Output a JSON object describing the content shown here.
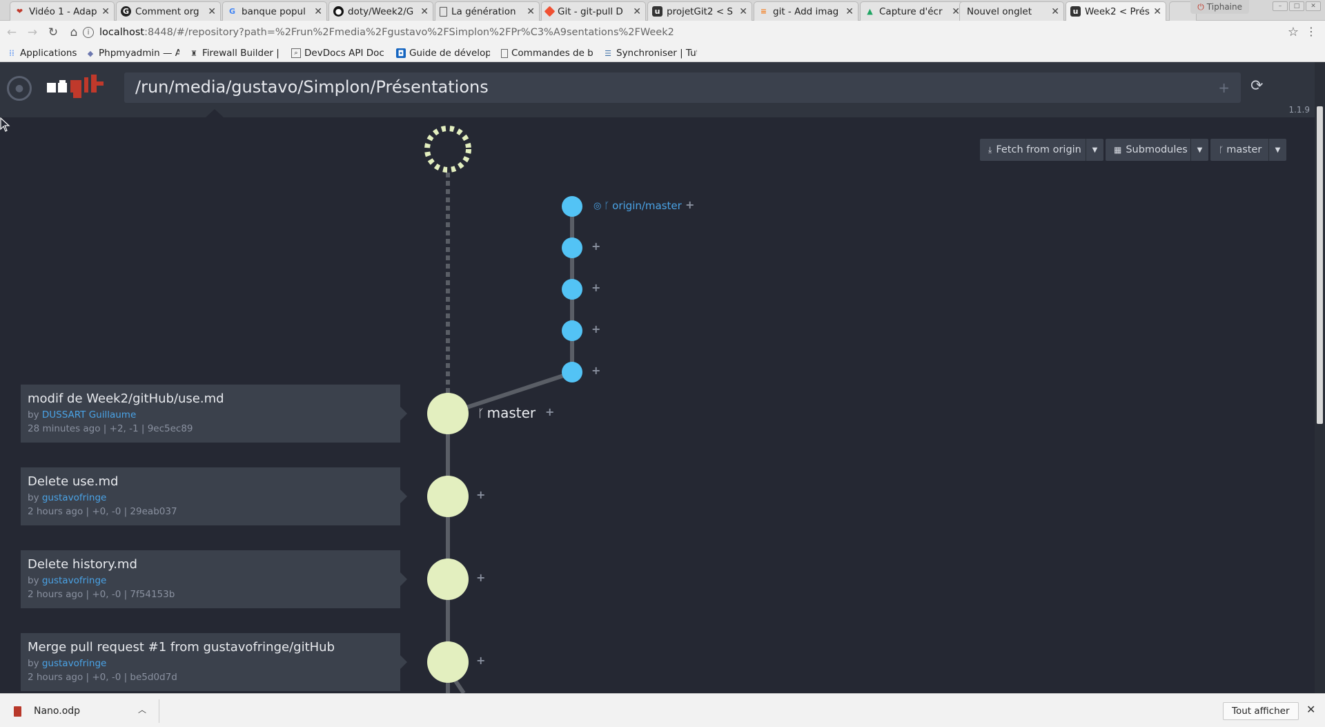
{
  "browser": {
    "tabs": [
      {
        "title": "Vidéo 1 - Adap",
        "icon": "video-icon"
      },
      {
        "title": "Comment org",
        "icon": "g-icon"
      },
      {
        "title": "banque popul",
        "icon": "google-icon"
      },
      {
        "title": "doty/Week2/G",
        "icon": "github-icon"
      },
      {
        "title": "La génération",
        "icon": "doc-icon"
      },
      {
        "title": "Git - git-pull D",
        "icon": "git-icon"
      },
      {
        "title": "projetGit2 < S",
        "icon": "ungit-icon"
      },
      {
        "title": "git - Add imag",
        "icon": "stack-icon"
      },
      {
        "title": "Capture d'écr",
        "icon": "drive-icon"
      },
      {
        "title": "Nouvel onglet",
        "icon": ""
      },
      {
        "title": "Week2 < Prés",
        "icon": "ungit-icon"
      }
    ],
    "profile": "Tiphaine",
    "url_host": "localhost",
    "url_rest": ":8448/#/repository?path=%2Frun%2Fmedia%2Fgustavo%2FSimplon%2FPr%C3%A9sentations%2FWeek2",
    "bookmarks": [
      {
        "label": "Applications",
        "icon": "apps-icon"
      },
      {
        "label": "Phpmyadmin — A",
        "icon": "phpmyadmin-icon"
      },
      {
        "label": "Firewall Builder |",
        "icon": "firewall-icon"
      },
      {
        "label": "DevDocs API Doc",
        "icon": "devdocs-icon"
      },
      {
        "label": "Guide de dévelop",
        "icon": "guide-icon"
      },
      {
        "label": "Commandes de b",
        "icon": "page-icon"
      },
      {
        "label": "Synchroniser | Tut",
        "icon": "db-icon"
      }
    ]
  },
  "ungit": {
    "path": "/run/media/gustavo/Simplon/Présentations",
    "version": "1.1.9",
    "toolbar": {
      "fetch_label": "Fetch from origin",
      "submodules_label": "Submodules",
      "branch_label": "master"
    },
    "refs": {
      "origin_master": "origin/master",
      "master": "master"
    },
    "commits": [
      {
        "title": "modif de Week2/gitHub/use.md",
        "by": "by",
        "author": "DUSSART Guillaume",
        "meta": "28 minutes ago | +2, -1 | 9ec5ec89"
      },
      {
        "title": "Delete use.md",
        "by": "by",
        "author": "gustavofringe",
        "meta": "2 hours ago | +0, -0 | 29eab037"
      },
      {
        "title": "Delete history.md",
        "by": "by",
        "author": "gustavofringe",
        "meta": "2 hours ago | +0, -0 | 7f54153b"
      },
      {
        "title": "Merge pull request #1 from gustavofringe/gitHub",
        "by": "by",
        "author": "gustavofringe",
        "meta": "2 hours ago | +0, -0 | be5d0d7d"
      }
    ],
    "colors": {
      "local_node": "#e3efbf",
      "remote_node": "#53c3f5",
      "edge": "#5a5e66",
      "link": "#4aa3e6"
    }
  },
  "downloads": {
    "file": "Nano.odp",
    "show_all": "Tout afficher"
  }
}
